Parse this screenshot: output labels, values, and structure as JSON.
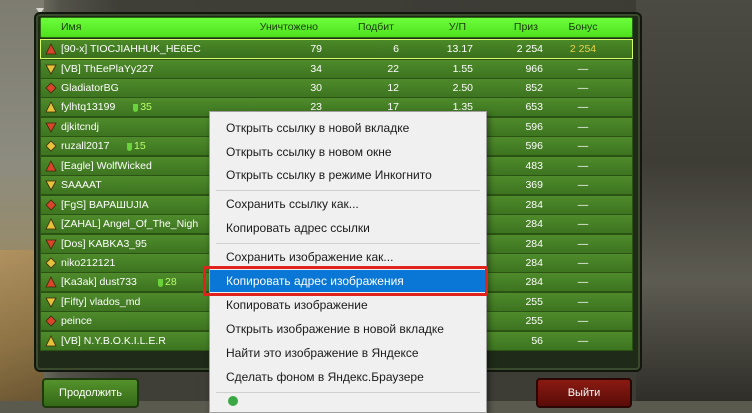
{
  "scoreboard": {
    "columns": {
      "name": "Имя",
      "kills": "Уничтожено",
      "deaths": "Подбит",
      "kd": "У/П",
      "prize": "Приз",
      "bonus": "Бонус"
    },
    "rows": [
      {
        "name": "[90-x] TIOCJIAHHUK_HE6EC",
        "kills": "79",
        "deaths": "6",
        "kd": "13.17",
        "prize": "2 254",
        "bonus": "2 254",
        "extra": ""
      },
      {
        "name": "[VB] ThEePlaYy227",
        "kills": "34",
        "deaths": "22",
        "kd": "1.55",
        "prize": "966",
        "bonus": "—",
        "extra": ""
      },
      {
        "name": "GladiatorBG",
        "kills": "30",
        "deaths": "12",
        "kd": "2.50",
        "prize": "852",
        "bonus": "—",
        "extra": ""
      },
      {
        "name": "fylhtq13199",
        "kills": "23",
        "deaths": "17",
        "kd": "1.35",
        "prize": "653",
        "bonus": "—",
        "extra": "35"
      },
      {
        "name": "djkitcndj",
        "kills": "",
        "deaths": "",
        "kd": "",
        "prize": "596",
        "bonus": "—",
        "extra": ""
      },
      {
        "name": "ruzall2017",
        "kills": "",
        "deaths": "",
        "kd": "",
        "prize": "596",
        "bonus": "—",
        "extra": "15"
      },
      {
        "name": "[Eagle] WolfWicked",
        "kills": "",
        "deaths": "",
        "kd": "",
        "prize": "483",
        "bonus": "—",
        "extra": ""
      },
      {
        "name": "SAAAAT",
        "kills": "",
        "deaths": "",
        "kd": "",
        "prize": "369",
        "bonus": "—",
        "extra": ""
      },
      {
        "name": "[FgS] BAPAШUJIA",
        "kills": "",
        "deaths": "",
        "kd": "",
        "prize": "284",
        "bonus": "—",
        "extra": ""
      },
      {
        "name": "[ZAHAL] Angel_Of_The_Nigh",
        "kills": "",
        "deaths": "",
        "kd": "",
        "prize": "284",
        "bonus": "—",
        "extra": ""
      },
      {
        "name": "[Dos] KABKA3_95",
        "kills": "",
        "deaths": "",
        "kd": "",
        "prize": "284",
        "bonus": "—",
        "extra": ""
      },
      {
        "name": "niko212121",
        "kills": "",
        "deaths": "",
        "kd": "",
        "prize": "284",
        "bonus": "—",
        "extra": ""
      },
      {
        "name": "[Ka3ak] dust733",
        "kills": "",
        "deaths": "",
        "kd": "",
        "prize": "284",
        "bonus": "—",
        "extra": "28"
      },
      {
        "name": "[Fifty] vlados_md",
        "kills": "",
        "deaths": "",
        "kd": "",
        "prize": "255",
        "bonus": "—",
        "extra": ""
      },
      {
        "name": "peince",
        "kills": "",
        "deaths": "",
        "kd": "",
        "prize": "255",
        "bonus": "—",
        "extra": ""
      },
      {
        "name": "[VB] N.Y.B.O.K.I.L.E.R",
        "kills": "",
        "deaths": "",
        "kd": "",
        "prize": "56",
        "bonus": "—",
        "extra": ""
      }
    ]
  },
  "buttons": {
    "continue": "Продолжить",
    "exit": "Выйти"
  },
  "context_menu": {
    "items": [
      "Открыть ссылку в новой вкладке",
      "Открыть ссылку в новом окне",
      "Открыть ссылку в режиме Инкогнито",
      "Сохранить ссылку как...",
      "Копировать адрес ссылки",
      "Сохранить изображение как...",
      "Копировать адрес изображения",
      "Копировать изображение",
      "Открыть изображение в новой вкладке",
      "Найти это изображение в Яндексе",
      "Сделать фоном в Яндекс.Браузере"
    ],
    "selected_index": 6
  },
  "colors": {
    "header_green": "#5ef02a",
    "row_green": "#46802a",
    "highlight_border": "#d7ff6a",
    "bonus_gold": "#e8d24a",
    "menu_selected": "#0a77d6",
    "annotation_red": "#e0231c"
  }
}
